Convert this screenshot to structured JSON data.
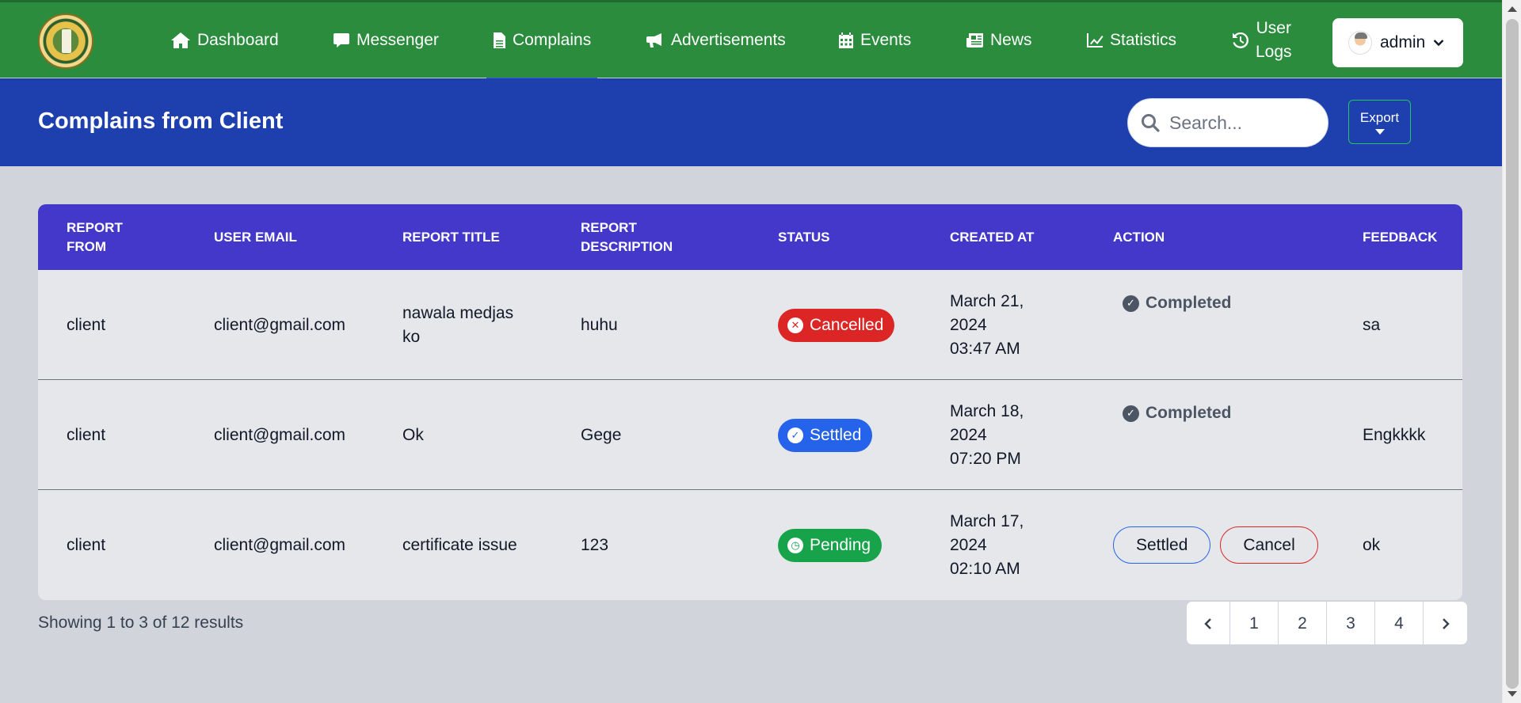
{
  "nav": {
    "items": [
      {
        "label": "Dashboard",
        "icon": "home-icon"
      },
      {
        "label": "Messenger",
        "icon": "chat-icon"
      },
      {
        "label": "Complains",
        "icon": "file-icon"
      },
      {
        "label": "Advertisements",
        "icon": "megaphone-icon"
      },
      {
        "label": "Events",
        "icon": "calendar-icon"
      },
      {
        "label": "News",
        "icon": "newspaper-icon"
      },
      {
        "label": "Statistics",
        "icon": "chart-line-icon"
      },
      {
        "label_line1": "User",
        "label_line2": "Logs",
        "icon": "history-icon"
      }
    ],
    "active": "Complains",
    "admin_label": "admin"
  },
  "header": {
    "title": "Complains from Client",
    "search_placeholder": "Search...",
    "export_label": "Export"
  },
  "table": {
    "columns": [
      {
        "line1": "Report",
        "line2": "From"
      },
      {
        "line1": "User Email",
        "line2": ""
      },
      {
        "line1": "Report Title",
        "line2": ""
      },
      {
        "line1": "Report",
        "line2": "Description"
      },
      {
        "line1": "Status",
        "line2": ""
      },
      {
        "line1": "Created At",
        "line2": ""
      },
      {
        "line1": "Action",
        "line2": ""
      },
      {
        "line1": "Feedback",
        "line2": ""
      }
    ],
    "rows": [
      {
        "from": "client",
        "email": "client@gmail.com",
        "title_line1": "nawala medjas",
        "title_line2": "ko",
        "description": "huhu",
        "status": "Cancelled",
        "created_line1": "March 21,",
        "created_line2": "2024",
        "created_line3": "03:47 AM",
        "action": "Completed",
        "feedback": "sa"
      },
      {
        "from": "client",
        "email": "client@gmail.com",
        "title_line1": "Ok",
        "title_line2": "",
        "description": "Gege",
        "status": "Settled",
        "created_line1": "March 18,",
        "created_line2": "2024",
        "created_line3": "07:20 PM",
        "action": "Completed",
        "feedback": "Engkkkk"
      },
      {
        "from": "client",
        "email": "client@gmail.com",
        "title_line1": "certificate issue",
        "title_line2": "",
        "description": "123",
        "status": "Pending",
        "created_line1": "March 17,",
        "created_line2": "2024",
        "created_line3": "02:10 AM",
        "action_settled": "Settled",
        "action_cancel": "Cancel",
        "feedback": "ok"
      }
    ]
  },
  "footer": {
    "showing": "Showing 1 to 3 of 12 results",
    "pages": [
      "1",
      "2",
      "3",
      "4"
    ]
  },
  "colors": {
    "navbar": "#2a8c3c",
    "header_band": "#1e40af",
    "table_head": "#4338ca",
    "cancelled": "#dc2626",
    "settled": "#2563eb",
    "pending": "#16a34a"
  }
}
